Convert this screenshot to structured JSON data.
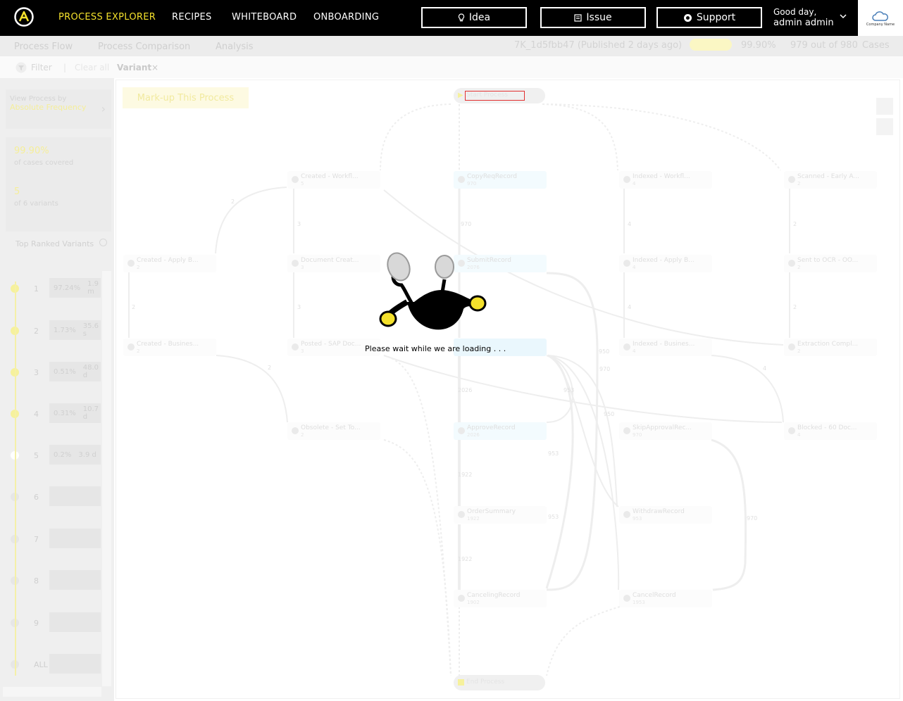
{
  "nav": {
    "items": [
      {
        "label": "PROCESS EXPLORER",
        "active": true
      },
      {
        "label": "RECIPES",
        "active": false
      },
      {
        "label": "WHITEBOARD",
        "active": false
      },
      {
        "label": "ONBOARDING",
        "active": false
      }
    ],
    "buttons": {
      "idea": "Idea",
      "issue": "Issue",
      "support": "Support"
    },
    "greeting": "Good day,",
    "user": "admin admin",
    "company": "Company Name"
  },
  "subnav": {
    "tabs": [
      "Process Flow",
      "Process Comparison",
      "Analysis"
    ],
    "version": "7K_1d5fbb47 (Published 2 days ago)",
    "coverage": "99.90%",
    "cases": "979 out of 980",
    "cases_label": "Cases"
  },
  "filterbar": {
    "filter": "Filter",
    "clear": "Clear all",
    "chip": "Variant"
  },
  "sidebar": {
    "view_by_label": "View Process by",
    "view_by_value": "Absolute Frequency",
    "coverage_value": "99.90%",
    "coverage_label": "of cases covered",
    "variants_value": "5",
    "variants_label": "of 6 variants",
    "top_ranked": "Top Ranked Variants",
    "variants": [
      {
        "rank": "1",
        "pct": "97.24%",
        "dur": "1.9 m"
      },
      {
        "rank": "2",
        "pct": "1.73%",
        "dur": "35.6 s"
      },
      {
        "rank": "3",
        "pct": "0.51%",
        "dur": "48.0 d"
      },
      {
        "rank": "4",
        "pct": "0.31%",
        "dur": "10.7 d"
      },
      {
        "rank": "5",
        "pct": "0.2%",
        "dur": "3.9 d"
      },
      {
        "rank": "6",
        "pct": "",
        "dur": ""
      },
      {
        "rank": "7",
        "pct": "",
        "dur": ""
      },
      {
        "rank": "8",
        "pct": "",
        "dur": ""
      },
      {
        "rank": "9",
        "pct": "",
        "dur": ""
      },
      {
        "rank": "ALL",
        "pct": "",
        "dur": ""
      }
    ]
  },
  "canvas": {
    "markup_button": "Mark-up This Process",
    "start_label": "Start Process",
    "end_label": "End Process",
    "nodes": [
      {
        "label": "Created - Workfl...",
        "count": "5"
      },
      {
        "label": "CopyReqRecord",
        "count": "970"
      },
      {
        "label": "Indexed - Workfl...",
        "count": "4"
      },
      {
        "label": "Scanned - Early A...",
        "count": "2"
      },
      {
        "label": "Created - Apply B...",
        "count": "2"
      },
      {
        "label": "Document Creat...",
        "count": "3"
      },
      {
        "label": "SubmitRecord",
        "count": "2076"
      },
      {
        "label": "Indexed - Apply B...",
        "count": "4"
      },
      {
        "label": "Sent to OCR - OO...",
        "count": "2"
      },
      {
        "label": "Created - Busines...",
        "count": "2"
      },
      {
        "label": "Posted - SAP Doc...",
        "count": "3"
      },
      {
        "label": "Indexed - Busines...",
        "count": "4"
      },
      {
        "label": "Extraction Compl...",
        "count": "2"
      },
      {
        "label": "Obsolete - Set To...",
        "count": "2"
      },
      {
        "label": "ApproveRecord",
        "count": "2026"
      },
      {
        "label": "SkipApprovalRec...",
        "count": "970"
      },
      {
        "label": "Blocked - 60 Doc...",
        "count": "4"
      },
      {
        "label": "OrderSummary",
        "count": "1922"
      },
      {
        "label": "WithdrawRecord",
        "count": "953"
      },
      {
        "label": "CancelingRecord",
        "count": "1902"
      },
      {
        "label": "CancelRecord",
        "count": "1953"
      }
    ],
    "edge_labels": [
      "2",
      "3",
      "970",
      "4",
      "2",
      "2",
      "3",
      "4",
      "2",
      "2",
      "2026",
      "950",
      "970",
      "953",
      "950",
      "953",
      "1922",
      "953",
      "1922",
      "970",
      "4"
    ]
  },
  "loading": {
    "text": "Please wait while we are loading . . ."
  }
}
